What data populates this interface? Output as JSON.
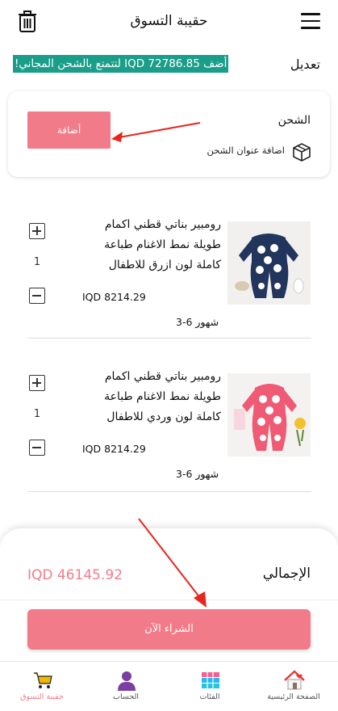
{
  "header": {
    "title": "حقيبة التسوق",
    "edit_label": "تعديل",
    "promo": "أضف IQD 72786.85 لتتمتع بالشحن المجاني!"
  },
  "shipping": {
    "title": "الشحن",
    "add_address": "اضافة عنوان الشحن",
    "add_button": "أضافة"
  },
  "items": [
    {
      "name": "رومبير بناتي قطني اكمام طويلة نمط الاغنام طباعة كاملة لون ازرق  للاطفال",
      "price": "IQD 8214.29",
      "size": "3-6 شهور",
      "qty": "1"
    },
    {
      "name": "رومبير بناتي قطني اكمام طويلة نمط الاغنام طباعة كاملة لون وردي للاطفال",
      "price": "IQD 8214.29",
      "size": "3-6 شهور",
      "qty": "1"
    }
  ],
  "summary": {
    "total_label": "الإجمالي",
    "total_value": "IQD 46145.92",
    "buy_button": "الشراء الآن"
  },
  "tabs": [
    {
      "label": "الصفحة الرئيسية",
      "icon": "home-icon"
    },
    {
      "label": "الفئات",
      "icon": "categories-icon"
    },
    {
      "label": "الحساب",
      "icon": "account-icon"
    },
    {
      "label": "حقيبة التسوق",
      "icon": "cart-icon",
      "active": true
    }
  ],
  "colors": {
    "accent": "#f27b89",
    "promo_bg": "#1a9e8a",
    "arrow": "#e8261c"
  }
}
